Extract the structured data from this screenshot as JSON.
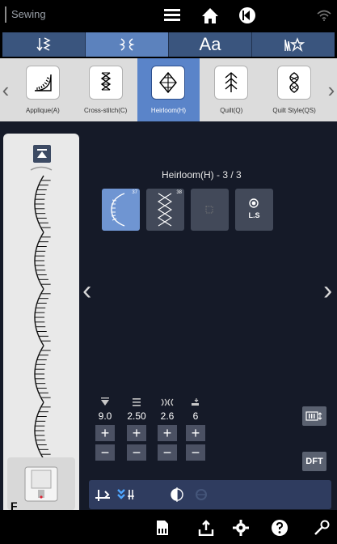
{
  "status": {
    "app_title": "Sewing",
    "icons": [
      "menu-icon",
      "home-icon",
      "back-icon",
      "wifi-icon"
    ]
  },
  "category_tabs": [
    {
      "icon": "utility-stitch-icon",
      "label": "",
      "active": false
    },
    {
      "icon": "decorative-stitch-icon",
      "label": "",
      "active": true
    },
    {
      "icon": "",
      "label": "Aa",
      "active": false
    },
    {
      "icon": "custom-stitch-icon",
      "label": "",
      "active": false
    }
  ],
  "groups": [
    {
      "label": "Applique(A)",
      "icon": "applique-icon",
      "active": false
    },
    {
      "label": "Cross-stitch(C)",
      "icon": "cross-stitch-icon",
      "active": false
    },
    {
      "label": "Heirloom(H)",
      "icon": "heirloom-icon",
      "active": true
    },
    {
      "label": "Quilt(Q)",
      "icon": "quilt-icon",
      "active": false
    },
    {
      "label": "Quilt Style(QS)",
      "icon": "quilt-style-icon",
      "active": false
    }
  ],
  "stitch_grid": {
    "title": "Heirloom(H) - 3 / 3",
    "cells": [
      {
        "num": "37",
        "icon": "scallop-stitch-icon",
        "selected": true
      },
      {
        "num": "38",
        "icon": "zigzag-stitch-icon",
        "selected": false
      },
      {
        "num": "",
        "icon": "empty-stitch-icon",
        "selected": false
      },
      {
        "num": "",
        "icon": "",
        "label": "L.S",
        "selected": false
      }
    ]
  },
  "adjust": [
    {
      "icon": "stitch-width-icon",
      "value": "9.0"
    },
    {
      "icon": "stitch-length-icon",
      "value": "2.50"
    },
    {
      "icon": "tension-icon",
      "value": "2.6"
    },
    {
      "icon": "presser-foot-pressure-icon",
      "value": "6"
    }
  ],
  "buttons": {
    "plus": "+",
    "minus": "−",
    "dft": "DFT"
  },
  "preview": {
    "foot_label": "F"
  },
  "toolbar_icons": [
    "needle-stop-icon",
    "twin-needle-icon",
    "mirror-icon",
    "rotate-icon"
  ],
  "nav_icons": [
    "memory-icon",
    "upload-icon",
    "settings-icon",
    "help-icon",
    "tool-icon"
  ]
}
